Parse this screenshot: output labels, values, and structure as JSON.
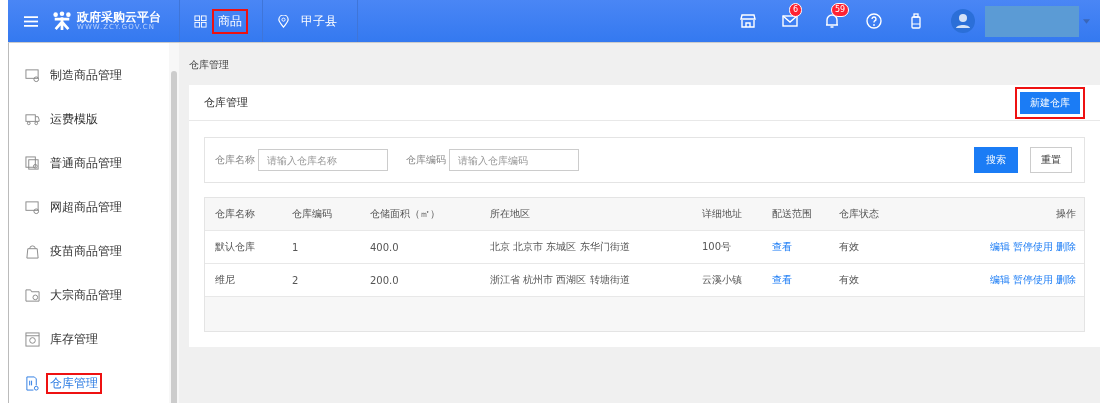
{
  "header": {
    "logo_title": "政府采购云平台",
    "logo_subtitle": "WWW.ZCY.GOV.CN",
    "nav": [
      {
        "label": "商品",
        "kind": "grid",
        "highlighted": true
      },
      {
        "label": "甲子县",
        "kind": "pin",
        "highlighted": false
      }
    ],
    "icons": [
      {
        "kind": "store"
      },
      {
        "kind": "mail",
        "badge": "6"
      },
      {
        "kind": "bell",
        "badge": "59"
      },
      {
        "kind": "help"
      },
      {
        "kind": "bottle"
      }
    ]
  },
  "sidebar": {
    "items": [
      {
        "label": "制造商品管理",
        "kind": "monitor",
        "selected": false,
        "highlighted": false
      },
      {
        "label": "运费模版",
        "kind": "truck",
        "selected": false,
        "highlighted": false
      },
      {
        "label": "普通商品管理",
        "kind": "stack",
        "selected": false,
        "highlighted": false
      },
      {
        "label": "网超商品管理",
        "kind": "monitor",
        "selected": false,
        "highlighted": false
      },
      {
        "label": "疫苗商品管理",
        "kind": "bag",
        "selected": false,
        "highlighted": false
      },
      {
        "label": "大宗商品管理",
        "kind": "folder",
        "selected": false,
        "highlighted": false
      },
      {
        "label": "库存管理",
        "kind": "window",
        "selected": false,
        "highlighted": false
      },
      {
        "label": "仓库管理",
        "kind": "doc",
        "selected": true,
        "highlighted": true
      }
    ]
  },
  "breadcrumb": "仓库管理",
  "panel": {
    "title": "仓库管理",
    "new_button": {
      "label": "新建仓库",
      "highlighted": true
    },
    "filters": [
      {
        "label": "仓库名称",
        "placeholder": "请输入仓库名称"
      },
      {
        "label": "仓库编码",
        "placeholder": "请输入仓库编码"
      }
    ],
    "search_button": "搜索",
    "reset_button": "重置",
    "table": {
      "columns": [
        "仓库名称",
        "仓库编码",
        "仓储面积（㎡）",
        "所在地区",
        "详细地址",
        "配送范围",
        "仓库状态",
        "操作"
      ],
      "rows": [
        {
          "name": "默认仓库",
          "code": "1",
          "area": "400.0",
          "region": "北京 北京市 东城区 东华门街道",
          "address": "100号",
          "scope": "查看",
          "status": "有效",
          "actions": [
            "编辑",
            "暂停使用",
            "删除"
          ]
        },
        {
          "name": "维尼",
          "code": "2",
          "area": "200.0",
          "region": "浙江省 杭州市 西湖区 转塘街道",
          "address": "云溪小镇",
          "scope": "查看",
          "status": "有效",
          "actions": [
            "编辑",
            "暂停使用",
            "删除"
          ]
        }
      ]
    }
  }
}
